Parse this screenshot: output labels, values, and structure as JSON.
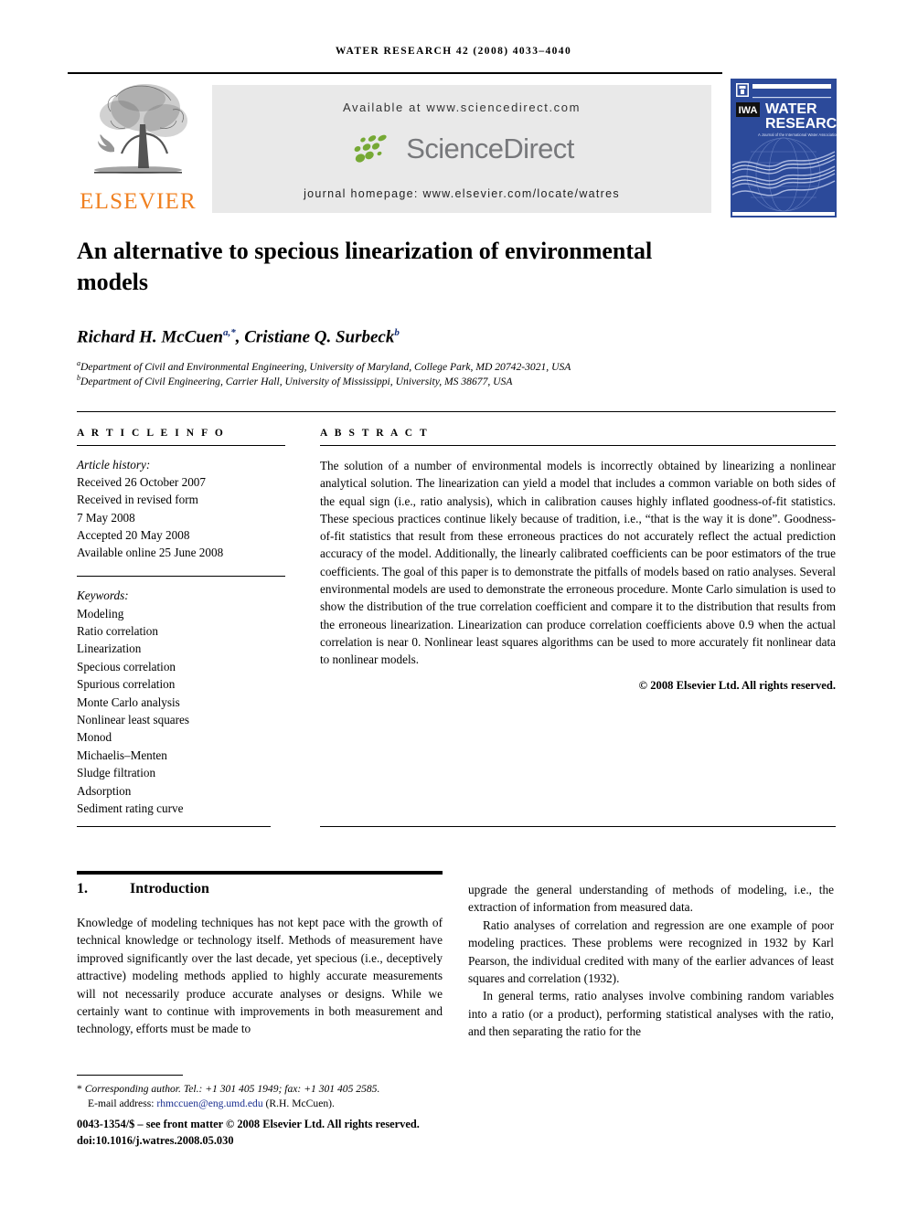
{
  "masthead": {
    "running_head": "WATER RESEARCH 42 (2008) 4033–4040",
    "available_at": "Available at www.sciencedirect.com",
    "sciencedirect_wordmark": "ScienceDirect",
    "journal_homepage": "journal homepage: www.elsevier.com/locate/watres",
    "elsevier_wordmark": "ELSEVIER",
    "cover": {
      "title_line1": "WATER",
      "title_line2": "RESEARCH",
      "tagline": "A Journal of the International Water Association",
      "imprint_mark": "IWA"
    },
    "colors": {
      "elsevier_orange": "#f08020",
      "sciencedirect_green": "#76a935",
      "sciencedirect_gray": "#77787b",
      "cover_blue": "#2c4a9a",
      "banner_gray": "#e9e9e9",
      "link_blue": "#1a2f8f"
    }
  },
  "article": {
    "title": "An alternative to specious linearization of environmental models",
    "authors_html": "Richard H. McCuen<sup>a,</sup><sup>*</sup>, Cristiane Q. Surbeck<sup>b</sup>",
    "affiliation_a": "Department of Civil and Environmental Engineering, University of Maryland, College Park, MD 20742-3021, USA",
    "affiliation_b": "Department of Civil Engineering, Carrier Hall, University of Mississippi, University, MS 38677, USA"
  },
  "article_info": {
    "heading": "A R T I C L E  I N F O",
    "history_label": "Article history:",
    "history": [
      "Received 26 October 2007",
      "Received in revised form",
      "7 May 2008",
      "Accepted 20 May 2008",
      "Available online 25 June 2008"
    ],
    "keywords_label": "Keywords:",
    "keywords": [
      "Modeling",
      "Ratio correlation",
      "Linearization",
      "Specious correlation",
      "Spurious correlation",
      "Monte Carlo analysis",
      "Nonlinear least squares",
      "Monod",
      "Michaelis–Menten",
      "Sludge filtration",
      "Adsorption",
      "Sediment rating curve"
    ]
  },
  "abstract": {
    "heading": "A B S T R A C T",
    "text": "The solution of a number of environmental models is incorrectly obtained by linearizing a nonlinear analytical solution. The linearization can yield a model that includes a common variable on both sides of the equal sign (i.e., ratio analysis), which in calibration causes highly inflated goodness-of-fit statistics. These specious practices continue likely because of tradition, i.e., “that is the way it is done”. Goodness-of-fit statistics that result from these erroneous practices do not accurately reflect the actual prediction accuracy of the model. Additionally, the linearly calibrated coefficients can be poor estimators of the true coefficients. The goal of this paper is to demonstrate the pitfalls of models based on ratio analyses. Several environmental models are used to demonstrate the erroneous procedure. Monte Carlo simulation is used to show the distribution of the true correlation coefficient and compare it to the distribution that results from the erroneous linearization. Linearization can produce correlation coefficients above 0.9 when the actual correlation is near 0. Nonlinear least squares algorithms can be used to more accurately fit nonlinear data to nonlinear models.",
    "copyright": "© 2008 Elsevier Ltd. All rights reserved."
  },
  "introduction": {
    "number": "1.",
    "heading": "Introduction",
    "left_paragraphs": [
      "Knowledge of modeling techniques has not kept pace with the growth of technical knowledge or technology itself. Methods of measurement have improved significantly over the last decade, yet specious (i.e., deceptively attractive) modeling methods applied to highly accurate measurements will not necessarily produce accurate analyses or designs. While we certainly want to continue with improvements in both measurement and technology, efforts must be made to"
    ],
    "right_paragraphs": [
      "upgrade the general understanding of methods of modeling, i.e., the extraction of information from measured data.",
      "Ratio analyses of correlation and regression are one example of poor modeling practices. These problems were recognized in 1932 by Karl Pearson, the individual credited with many of the earlier advances of least squares and correlation (1932).",
      "In general terms, ratio analyses involve combining random variables into a ratio (or a product), performing statistical analyses with the ratio, and then separating the ratio for the"
    ]
  },
  "footer": {
    "corresponding_star": "*",
    "corresponding_author": "Corresponding author. Tel.: +1 301 405 1949; fax: +1 301 405 2585.",
    "email_label": "E-mail address:",
    "email": "rhmccuen@eng.umd.edu",
    "email_owner": "(R.H. McCuen).",
    "issn_line": "0043-1354/$ – see front matter © 2008 Elsevier Ltd. All rights reserved.",
    "doi_line": "doi:10.1016/j.watres.2008.05.030"
  }
}
